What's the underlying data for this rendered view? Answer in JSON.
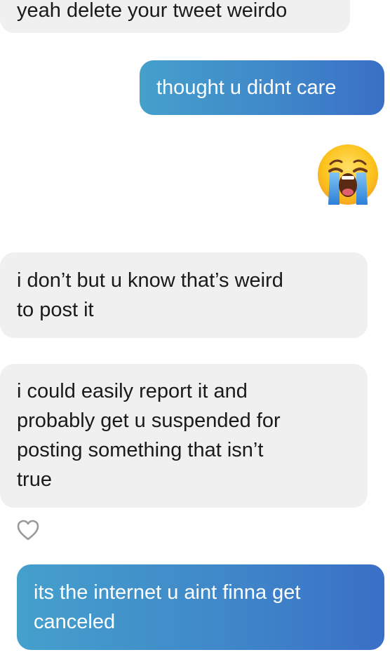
{
  "conversation": {
    "messages": [
      {
        "direction": "incoming",
        "text": "yeah delete your tweet weirdo"
      },
      {
        "direction": "outgoing",
        "text": "thought u didnt care"
      },
      {
        "direction": "outgoing",
        "type": "emoji",
        "emoji": "loudly-crying-face"
      },
      {
        "direction": "incoming",
        "text": "i don’t but u know that’s weird\nto post it"
      },
      {
        "direction": "incoming",
        "text": "i could easily report it and\nprobably get u suspended for\nposting something that isn’t\ntrue"
      },
      {
        "direction": "outgoing",
        "text": "its the internet u aint finna get\ncanceled"
      }
    ],
    "like_icon": "heart-outline-icon"
  },
  "colors": {
    "incoming_bubble": "#f0f0f1",
    "outgoing_gradient_start": "#45a0cc",
    "outgoing_gradient_end": "#3a6fc6",
    "incoming_text": "#1a1a1a",
    "outgoing_text": "#ffffff"
  }
}
